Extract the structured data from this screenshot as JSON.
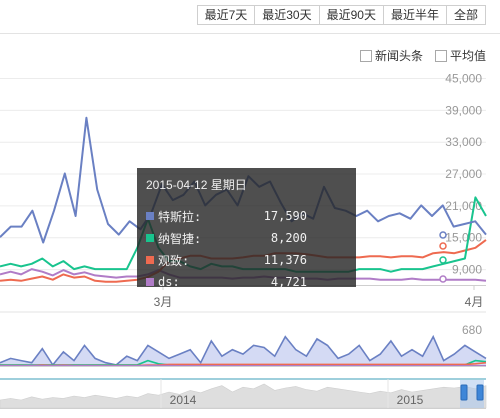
{
  "range_buttons": [
    "最近7天",
    "最近30天",
    "最近90天",
    "最近半年",
    "全部"
  ],
  "toggles": [
    "新闻头条",
    "平均值"
  ],
  "tooltip": {
    "date": "2015-04-12 星期日",
    "rows": [
      {
        "name": "特斯拉",
        "sep": ":",
        "value": "17,590",
        "color": "#6a80c3"
      },
      {
        "name": "纳智捷",
        "sep": ":",
        "value": "8,200",
        "color": "#19c48e"
      },
      {
        "name": "观致",
        "sep": ":",
        "value": "11,376",
        "color": "#ee6a50"
      },
      {
        "name": "ds",
        "sep": ":",
        "value": "4,721",
        "color": "#b07cc7"
      }
    ]
  },
  "chart_data": {
    "type": "line",
    "x_labels": [
      "3月",
      "4月"
    ],
    "yticks": [
      "45,000",
      "39,000",
      "33,000",
      "27,000",
      "21,000",
      "15,000",
      "9,000"
    ],
    "y_range": [
      6000,
      45000
    ],
    "series": [
      {
        "name": "特斯拉",
        "color": "#6a80c3",
        "values": [
          15000,
          17000,
          17000,
          20000,
          14000,
          20000,
          27000,
          19000,
          37500,
          24000,
          17500,
          15500,
          18000,
          16500,
          19500,
          25000,
          22000,
          23000,
          25500,
          21000,
          23000,
          24000,
          21000,
          26500,
          24500,
          25500,
          21500,
          18000,
          19500,
          18500,
          24500,
          20500,
          20000,
          19000,
          20000,
          18000,
          19000,
          19500,
          18500,
          21000,
          19000,
          21000,
          17000,
          17500,
          18000,
          15500
        ]
      },
      {
        "name": "纳智捷",
        "color": "#19c48e",
        "values": [
          9500,
          10000,
          9500,
          10000,
          11000,
          9500,
          10500,
          9000,
          9500,
          9000,
          9000,
          9000,
          9000,
          13000,
          18500,
          13000,
          10500,
          10500,
          9500,
          9000,
          10000,
          9500,
          9500,
          9000,
          9000,
          9000,
          9000,
          9000,
          8500,
          8500,
          8500,
          8500,
          8500,
          8500,
          9000,
          9000,
          9000,
          8500,
          9000,
          9000,
          9000,
          9500,
          10000,
          10500,
          11000,
          22500,
          19000
        ]
      },
      {
        "name": "观致",
        "color": "#ee6a50",
        "values": [
          6800,
          7000,
          6800,
          7200,
          7600,
          7000,
          8000,
          7400,
          7600,
          6800,
          6600,
          6600,
          6800,
          7000,
          7500,
          8500,
          10500,
          11000,
          11500,
          11500,
          11000,
          11000,
          11000,
          11200,
          11500,
          11500,
          12000,
          12000,
          12000,
          11800,
          11500,
          11200,
          11200,
          11200,
          11200,
          11400,
          11400,
          11200,
          11400,
          11400,
          11200,
          12000,
          12200,
          12000,
          12500,
          13000,
          14500
        ]
      },
      {
        "name": "ds",
        "color": "#b07cc7",
        "values": [
          8000,
          8500,
          8000,
          9000,
          8500,
          7800,
          8800,
          8000,
          8400,
          7800,
          7600,
          7400,
          7600,
          7600,
          8000,
          8800,
          8000,
          7400,
          7400,
          7400,
          7400,
          7400,
          7200,
          7400,
          7400,
          7600,
          7400,
          7400,
          7400,
          7200,
          7200,
          7000,
          7200,
          7200,
          7200,
          7200,
          7000,
          7000,
          7000,
          7200,
          7000,
          7000,
          7000,
          7000,
          7000,
          7000,
          6800
        ]
      }
    ],
    "lower_panel": {
      "ytick": "680",
      "series": [
        {
          "name": "特斯拉",
          "color": "#6a80c3",
          "values": [
            360,
            400,
            380,
            360,
            490,
            340,
            460,
            380,
            520,
            400,
            360,
            340,
            420,
            380,
            520,
            460,
            400,
            440,
            480,
            360,
            560,
            420,
            480,
            440,
            520,
            500,
            420,
            600,
            480,
            420,
            580,
            520,
            400,
            440,
            520,
            380,
            440,
            560,
            420,
            480,
            420,
            600,
            380,
            440,
            520,
            460,
            400
          ]
        },
        {
          "name": "纳智捷",
          "color": "#19c48e",
          "values": [
            340,
            340,
            340,
            340,
            340,
            340,
            340,
            340,
            340,
            340,
            340,
            340,
            340,
            340,
            380,
            350,
            340,
            340,
            340,
            340,
            340,
            340,
            340,
            340,
            340,
            340,
            340,
            340,
            340,
            340,
            340,
            340,
            340,
            340,
            340,
            340,
            340,
            340,
            340,
            340,
            340,
            340,
            340,
            340,
            340,
            380,
            370
          ]
        },
        {
          "name": "观致",
          "color": "#ee6a50",
          "values": [
            335,
            335,
            335,
            335,
            338,
            335,
            338,
            335,
            335,
            335,
            335,
            335,
            335,
            335,
            338,
            340,
            345,
            345,
            345,
            345,
            345,
            345,
            345,
            345,
            345,
            345,
            345,
            345,
            345,
            345,
            345,
            345,
            345,
            345,
            345,
            345,
            345,
            345,
            345,
            345,
            345,
            345,
            345,
            345,
            345,
            350,
            360
          ]
        },
        {
          "name": "ds",
          "color": "#b07cc7",
          "values": [
            332,
            333,
            332,
            334,
            333,
            332,
            334,
            332,
            333,
            332,
            332,
            332,
            332,
            332,
            333,
            334,
            333,
            332,
            332,
            332,
            332,
            332,
            332,
            332,
            332,
            332,
            332,
            332,
            332,
            332,
            332,
            332,
            332,
            332,
            332,
            332,
            332,
            332,
            332,
            332,
            332,
            332,
            332,
            332,
            332,
            332,
            332
          ]
        }
      ]
    },
    "navigator": {
      "labels": [
        "2014",
        "2015"
      ]
    }
  }
}
